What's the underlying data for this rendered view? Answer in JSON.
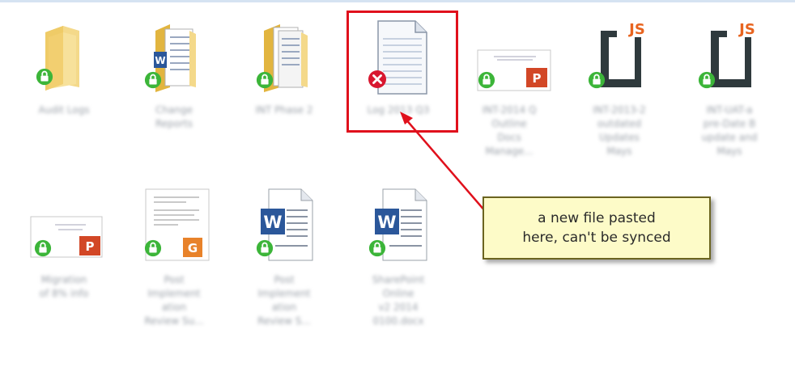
{
  "files": [
    {
      "id": "f1",
      "type": "folder",
      "sync": "synced",
      "name_lines": [
        "Audit Logs",
        ""
      ]
    },
    {
      "id": "f2",
      "type": "folder-doc",
      "sync": "synced",
      "name_lines": [
        "Change",
        "Reports"
      ]
    },
    {
      "id": "f3",
      "type": "folder-docs",
      "sync": "synced",
      "name_lines": [
        "INT Phase 2",
        ""
      ]
    },
    {
      "id": "f4",
      "type": "text",
      "sync": "error",
      "name_lines": [
        "Log 2013 Q3",
        ""
      ]
    },
    {
      "id": "f5",
      "type": "ppt-slide",
      "sync": "synced",
      "name_lines": [
        "INT-2014 Q",
        "Outline",
        "Docs",
        "Manage..."
      ]
    },
    {
      "id": "f6",
      "type": "js",
      "sync": "synced",
      "name_lines": [
        "INT-2013-2",
        "outdated",
        "Updates",
        "Mays"
      ]
    },
    {
      "id": "f7",
      "type": "js",
      "sync": "synced",
      "name_lines": [
        "INT-UAT-a",
        "pre-Date B",
        "update and",
        "Mays"
      ]
    },
    {
      "id": "f8",
      "type": "ppt-slide2",
      "sync": "synced",
      "name_lines": [
        "Migration",
        "of 8% info"
      ]
    },
    {
      "id": "f9",
      "type": "scan-doc",
      "sync": "synced",
      "name_lines": [
        "Post",
        "Implement",
        "ation",
        "Review Su..."
      ]
    },
    {
      "id": "f10",
      "type": "word",
      "sync": "synced",
      "name_lines": [
        "Post",
        "Implement",
        "ation",
        "Review S..."
      ]
    },
    {
      "id": "f11",
      "type": "word",
      "sync": "synced",
      "name_lines": [
        "SharePoint",
        "Online",
        "v2 2014",
        "0100.docx"
      ]
    }
  ],
  "callout": {
    "line1": "a new file pasted",
    "line2": "here, can't be synced"
  },
  "colors": {
    "highlight": "#e0101c",
    "sync_ok": "#3cb539",
    "sync_error": "#d81830",
    "callout_bg": "#fdfbc8"
  }
}
